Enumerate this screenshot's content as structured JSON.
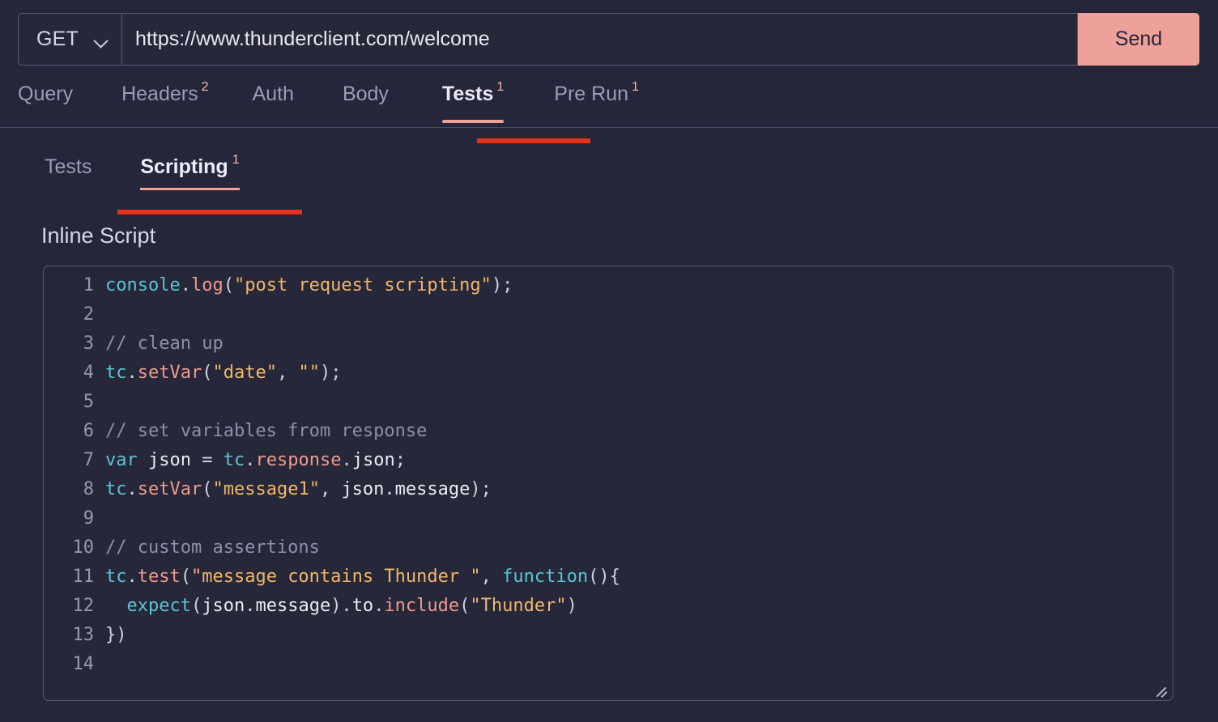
{
  "request": {
    "method": "GET",
    "method_icon": "chevron-down-icon",
    "url": "https://www.thunderclient.com/welcome",
    "url_placeholder": "Enter request URL",
    "send_label": "Send"
  },
  "main_tabs": [
    {
      "label": "Query",
      "badge": "",
      "active": false
    },
    {
      "label": "Headers",
      "badge": "2",
      "active": false
    },
    {
      "label": "Auth",
      "badge": "",
      "active": false
    },
    {
      "label": "Body",
      "badge": "",
      "active": false
    },
    {
      "label": "Tests",
      "badge": "1",
      "active": true
    },
    {
      "label": "Pre Run",
      "badge": "1",
      "active": false
    }
  ],
  "sub_tabs": [
    {
      "label": "Tests",
      "badge": "",
      "active": false
    },
    {
      "label": "Scripting",
      "badge": "1",
      "active": true
    }
  ],
  "section": {
    "title": "Inline Script"
  },
  "editor": {
    "line_numbers": [
      "1",
      "2",
      "3",
      "4",
      "5",
      "6",
      "7",
      "8",
      "9",
      "10",
      "11",
      "12",
      "13",
      "14"
    ],
    "lines": [
      "console.log(\"post request scripting\");",
      "",
      "// clean up",
      "tc.setVar(\"date\", \"\");",
      "",
      "// set variables from response",
      "var json = tc.response.json;",
      "tc.setVar(\"message1\", json.message);",
      "",
      "// custom assertions",
      "tc.test(\"message contains Thunder \", function(){",
      "  expect(json.message).to.include(\"Thunder\")",
      "})",
      ""
    ],
    "resize_handle": "resize-grip-icon"
  },
  "colors": {
    "background": "#252639",
    "panel": "#262739",
    "accent": "#eda19a",
    "annotation": "#e8311a",
    "border": "#575869",
    "text": "#e7e8f5",
    "muted": "#9b9db7",
    "syntax_keyword": "#5cc3d6",
    "syntax_function": "#ef9a8f",
    "syntax_string": "#f0b86e",
    "syntax_comment": "#8d90a8"
  }
}
